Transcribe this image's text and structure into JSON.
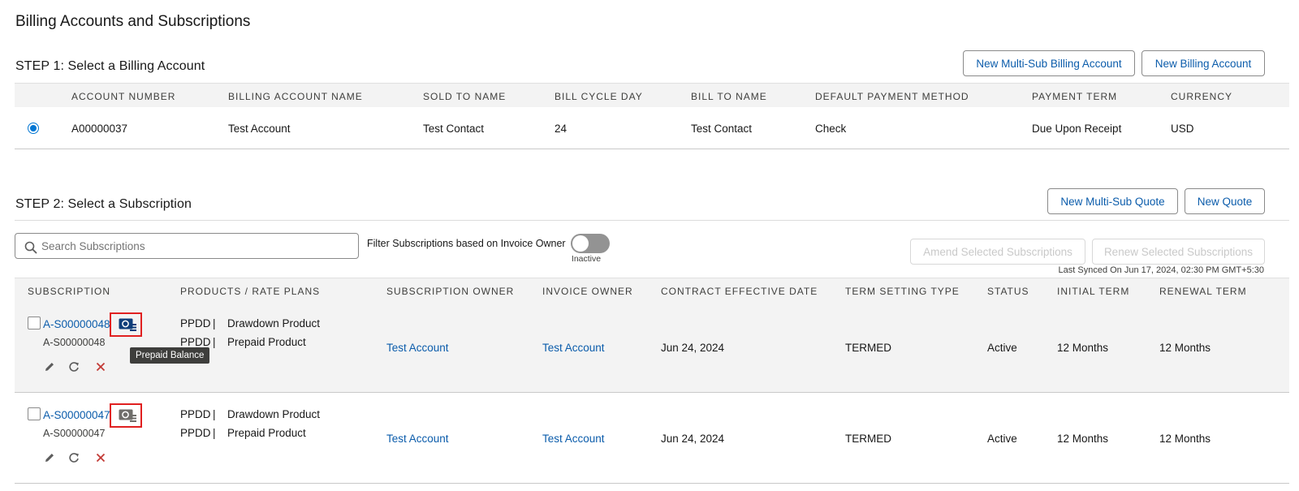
{
  "page": {
    "title": "Billing Accounts and Subscriptions"
  },
  "step1": {
    "title": "STEP 1: Select a Billing Account",
    "buttons": {
      "new_multi_sub_billing": "New Multi-Sub Billing Account",
      "new_billing": "New Billing Account"
    },
    "columns": [
      "ACCOUNT NUMBER",
      "BILLING ACCOUNT NAME",
      "SOLD TO NAME",
      "BILL CYCLE DAY",
      "BILL TO NAME",
      "DEFAULT PAYMENT METHOD",
      "PAYMENT TERM",
      "CURRENCY"
    ],
    "row": {
      "selected": true,
      "account_number": "A00000037",
      "billing_account_name": "Test Account",
      "sold_to_name": "Test Contact",
      "bill_cycle_day": "24",
      "bill_to_name": "Test Contact",
      "default_payment_method": "Check",
      "payment_term": "Due Upon Receipt",
      "currency": "USD"
    }
  },
  "step2": {
    "title": "STEP 2: Select a Subscription",
    "buttons": {
      "new_multi_sub_quote": "New Multi-Sub Quote",
      "new_quote": "New Quote",
      "amend_selected": "Amend Selected Subscriptions",
      "renew_selected": "Renew Selected Subscriptions"
    },
    "search": {
      "placeholder": "Search Subscriptions",
      "value": ""
    },
    "filter": {
      "label": "Filter Subscriptions based on Invoice Owner",
      "state": "Inactive",
      "on": false
    },
    "last_synced": "Last Synced On Jun 17, 2024, 02:30 PM GMT+5:30",
    "columns": [
      "SUBSCRIPTION",
      "PRODUCTS / RATE PLANS",
      "SUBSCRIPTION OWNER",
      "INVOICE OWNER",
      "CONTRACT EFFECTIVE DATE",
      "TERM SETTING TYPE",
      "STATUS",
      "INITIAL TERM",
      "RENEWAL TERM"
    ],
    "rows": [
      {
        "subscription_link": "A-S00000048",
        "subscription_id": "A-S00000048",
        "plans": [
          {
            "code": "PPDD",
            "sep": "|",
            "name": "Drawdown Product"
          },
          {
            "code": "PPDD",
            "sep": "|",
            "name": "Prepaid Product"
          }
        ],
        "subscription_owner": "Test Account",
        "invoice_owner": "Test Account",
        "contract_effective_date": "Jun 24, 2024",
        "term_setting_type": "TERMED",
        "status": "Active",
        "initial_term": "12 Months",
        "renewal_term": "12 Months"
      },
      {
        "subscription_link": "A-S00000047",
        "subscription_id": "A-S00000047",
        "plans": [
          {
            "code": "PPDD",
            "sep": "|",
            "name": "Drawdown Product"
          },
          {
            "code": "PPDD",
            "sep": "|",
            "name": "Prepaid Product"
          }
        ],
        "subscription_owner": "Test Account",
        "invoice_owner": "Test Account",
        "contract_effective_date": "Jun 24, 2024",
        "term_setting_type": "TERMED",
        "status": "Active",
        "initial_term": "12 Months",
        "renewal_term": "12 Months"
      }
    ],
    "tooltip": "Prepaid Balance"
  },
  "icons": {
    "search": "search-icon",
    "balance": "prepaid-balance-icon",
    "edit": "pencil-icon",
    "renew": "redo-icon",
    "cancel": "close-icon"
  },
  "colors": {
    "link": "#0b5cab",
    "radio": "#0176d3",
    "cancel": "#c23934",
    "highlight": "#e02020",
    "header_bg": "#f3f3f3"
  }
}
